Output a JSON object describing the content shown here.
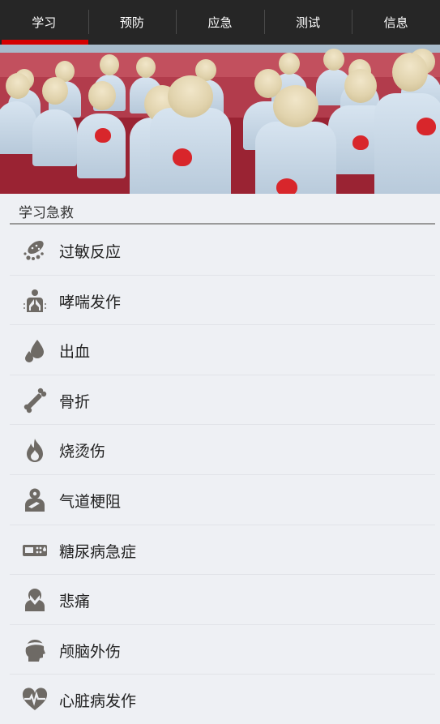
{
  "tabs": [
    {
      "label": "学习",
      "active": true
    },
    {
      "label": "预防",
      "active": false
    },
    {
      "label": "应急",
      "active": false
    },
    {
      "label": "测试",
      "active": false
    },
    {
      "label": "信息",
      "active": false
    }
  ],
  "section": {
    "title": "学习急救"
  },
  "items": [
    {
      "label": "过敏反应",
      "icon": "allergy-icon"
    },
    {
      "label": "哮喘发作",
      "icon": "lungs-icon"
    },
    {
      "label": "出血",
      "icon": "blood-drop-icon"
    },
    {
      "label": "骨折",
      "icon": "bone-icon"
    },
    {
      "label": "烧烫伤",
      "icon": "flame-icon"
    },
    {
      "label": "气道梗阻",
      "icon": "choking-icon"
    },
    {
      "label": "糖尿病急症",
      "icon": "glucose-meter-icon"
    },
    {
      "label": "悲痛",
      "icon": "grief-icon"
    },
    {
      "label": "颅脑外伤",
      "icon": "head-injury-icon"
    },
    {
      "label": "心脏病发作",
      "icon": "heartbeat-icon"
    }
  ],
  "colors": {
    "tab_bar": "#262626",
    "accent": "#d40000",
    "icon": "#6e6a65",
    "background": "#eef0f4"
  }
}
